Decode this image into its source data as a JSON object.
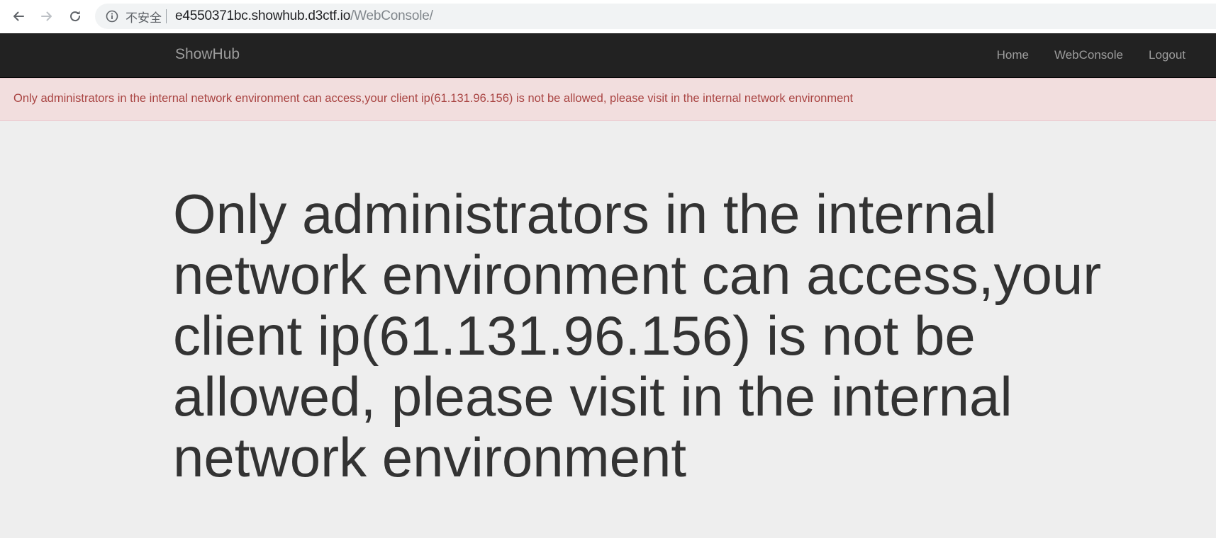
{
  "browser": {
    "security_label": "不安全",
    "url_host": "e4550371bc.showhub.d3ctf.io",
    "url_path": "/WebConsole/",
    "icons": {
      "back": "arrow-left-icon",
      "forward": "arrow-right-icon",
      "reload": "reload-icon",
      "info": "info-icon"
    }
  },
  "navbar": {
    "brand": "ShowHub",
    "links": [
      {
        "label": "Home"
      },
      {
        "label": "WebConsole"
      },
      {
        "label": "Logout"
      }
    ]
  },
  "alert": {
    "message": "Only administrators in the internal network environment can access,your client ip(61.131.96.156) is not be allowed, please visit in the internal network environment"
  },
  "main": {
    "heading": "Only administrators in the internal network environment can access,your client ip(61.131.96.156) is not be allowed, please visit in the internal network environment"
  },
  "colors": {
    "navbar_bg": "#222222",
    "navbar_text": "#9d9d9d",
    "alert_bg": "#f2dede",
    "alert_text": "#a94442",
    "page_bg": "#eeeeee",
    "heading_text": "#333333"
  }
}
